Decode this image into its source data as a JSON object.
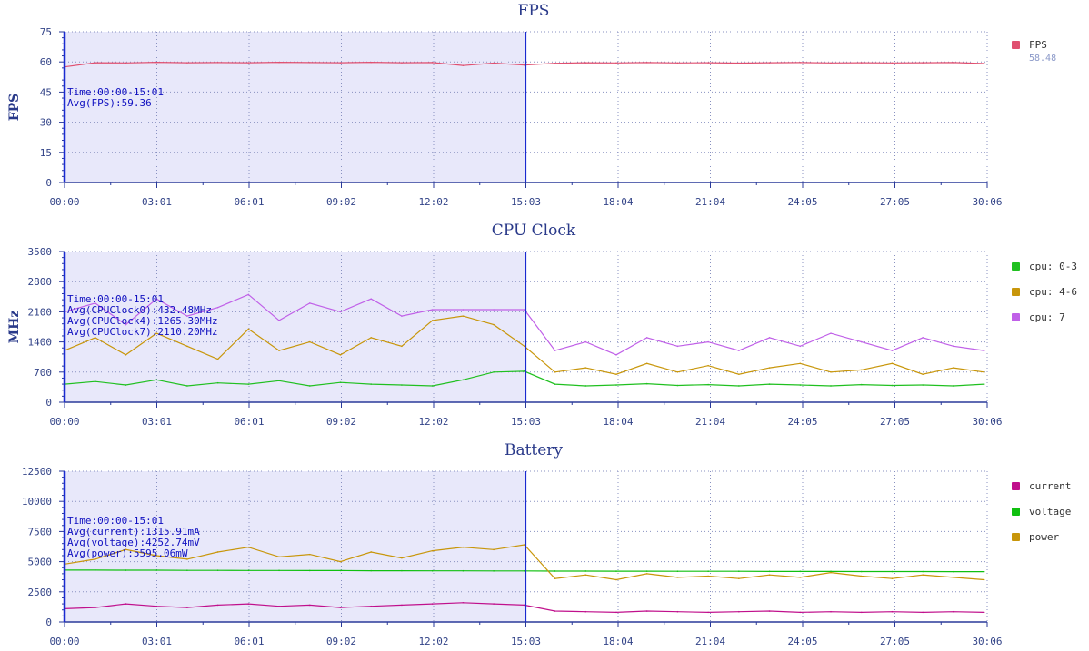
{
  "x_ticks": [
    "00:00",
    "03:01",
    "06:01",
    "09:02",
    "12:02",
    "15:03",
    "18:04",
    "21:04",
    "24:05",
    "27:05",
    "30:06"
  ],
  "selection": {
    "start": "00:00",
    "end": "15:01"
  },
  "chart_data": [
    {
      "type": "line",
      "title": "FPS",
      "ylabel": "FPS",
      "ylim": [
        0,
        75
      ],
      "yticks": [
        "0",
        "15",
        "30",
        "45",
        "60",
        "75"
      ],
      "x_minutes": [
        0,
        1,
        2,
        3,
        4,
        5,
        6,
        7,
        8,
        9,
        10,
        11,
        12,
        13,
        14,
        15,
        16,
        17,
        18,
        19,
        20,
        21,
        22,
        23,
        24,
        25,
        26,
        27,
        28,
        29,
        30
      ],
      "grid": true,
      "legend_position": "right",
      "series": [
        {
          "name": "FPS",
          "color": "#e05070",
          "summary": "58.48",
          "values": [
            57.5,
            59.6,
            59.5,
            59.8,
            59.6,
            59.7,
            59.6,
            59.8,
            59.7,
            59.6,
            59.8,
            59.6,
            59.7,
            58.2,
            59.4,
            58.4,
            59.3,
            59.6,
            59.5,
            59.7,
            59.5,
            59.6,
            59.4,
            59.6,
            59.7,
            59.5,
            59.6,
            59.5,
            59.6,
            59.7,
            59.2
          ]
        }
      ],
      "annotation": [
        "Time:00:00-15:01",
        "Avg(FPS):59.36"
      ]
    },
    {
      "type": "line",
      "title": "CPU Clock",
      "ylabel": "MHz",
      "ylim": [
        0,
        3500
      ],
      "yticks": [
        "0",
        "700",
        "1400",
        "2100",
        "2800",
        "3500"
      ],
      "x_minutes": [
        0,
        1,
        2,
        3,
        4,
        5,
        6,
        7,
        8,
        9,
        10,
        11,
        12,
        13,
        14,
        15,
        16,
        17,
        18,
        19,
        20,
        21,
        22,
        23,
        24,
        25,
        26,
        27,
        28,
        29,
        30
      ],
      "grid": true,
      "legend_position": "right",
      "series": [
        {
          "name": "cpu: 0-3",
          "color": "#20c020",
          "values": [
            420,
            480,
            400,
            520,
            380,
            450,
            420,
            500,
            380,
            460,
            420,
            400,
            380,
            520,
            700,
            720,
            420,
            380,
            400,
            430,
            390,
            410,
            380,
            420,
            400,
            380,
            410,
            390,
            400,
            380,
            420
          ]
        },
        {
          "name": "cpu: 4-6",
          "color": "#c8960a",
          "values": [
            1200,
            1500,
            1100,
            1600,
            1300,
            1000,
            1700,
            1200,
            1400,
            1100,
            1500,
            1300,
            1900,
            2000,
            1800,
            1300,
            700,
            800,
            650,
            900,
            700,
            850,
            650,
            800,
            900,
            700,
            750,
            900,
            650,
            800,
            700
          ]
        },
        {
          "name": "cpu: 7",
          "color": "#c060e8",
          "values": [
            2100,
            2300,
            1800,
            2400,
            2000,
            2200,
            2500,
            1900,
            2300,
            2100,
            2400,
            2000,
            2150,
            2150,
            2150,
            2150,
            1200,
            1400,
            1100,
            1500,
            1300,
            1400,
            1200,
            1500,
            1300,
            1600,
            1400,
            1200,
            1500,
            1300,
            1200
          ]
        }
      ],
      "annotation": [
        "Time:00:00-15:01",
        "Avg(CPUClock0):432.48MHz",
        "Avg(CPUClock4):1265.30MHz",
        "Avg(CPUClock7):2110.20MHz"
      ]
    },
    {
      "type": "line",
      "title": "Battery",
      "ylabel": "",
      "ylim": [
        0,
        12500
      ],
      "yticks": [
        "0",
        "2500",
        "5000",
        "7500",
        "10000",
        "12500"
      ],
      "x_minutes": [
        0,
        1,
        2,
        3,
        4,
        5,
        6,
        7,
        8,
        9,
        10,
        11,
        12,
        13,
        14,
        15,
        16,
        17,
        18,
        19,
        20,
        21,
        22,
        23,
        24,
        25,
        26,
        27,
        28,
        29,
        30
      ],
      "grid": true,
      "legend_position": "right",
      "series": [
        {
          "name": "current",
          "color": "#c0108c",
          "values": [
            1100,
            1200,
            1500,
            1300,
            1200,
            1400,
            1500,
            1300,
            1400,
            1200,
            1300,
            1400,
            1500,
            1600,
            1500,
            1400,
            900,
            850,
            800,
            900,
            850,
            800,
            850,
            900,
            800,
            850,
            800,
            850,
            800,
            850,
            800
          ]
        },
        {
          "name": "voltage",
          "color": "#10c010",
          "values": [
            4300,
            4300,
            4290,
            4290,
            4280,
            4280,
            4270,
            4270,
            4260,
            4260,
            4250,
            4250,
            4240,
            4240,
            4230,
            4230,
            4220,
            4220,
            4210,
            4210,
            4200,
            4200,
            4200,
            4190,
            4190,
            4190,
            4180,
            4180,
            4180,
            4170,
            4170
          ]
        },
        {
          "name": "power",
          "color": "#c8960a",
          "values": [
            4800,
            5200,
            6000,
            5500,
            5200,
            5800,
            6200,
            5400,
            5600,
            5000,
            5800,
            5300,
            5900,
            6200,
            6000,
            6400,
            3600,
            3900,
            3500,
            4000,
            3700,
            3800,
            3600,
            3900,
            3700,
            4100,
            3800,
            3600,
            3900,
            3700,
            3500
          ]
        }
      ],
      "annotation": [
        "Time:00:00-15:01",
        "Avg(current):1315.91mA",
        "Avg(voltage):4252.74mV",
        "Avg(power):5595.06mW"
      ]
    }
  ]
}
